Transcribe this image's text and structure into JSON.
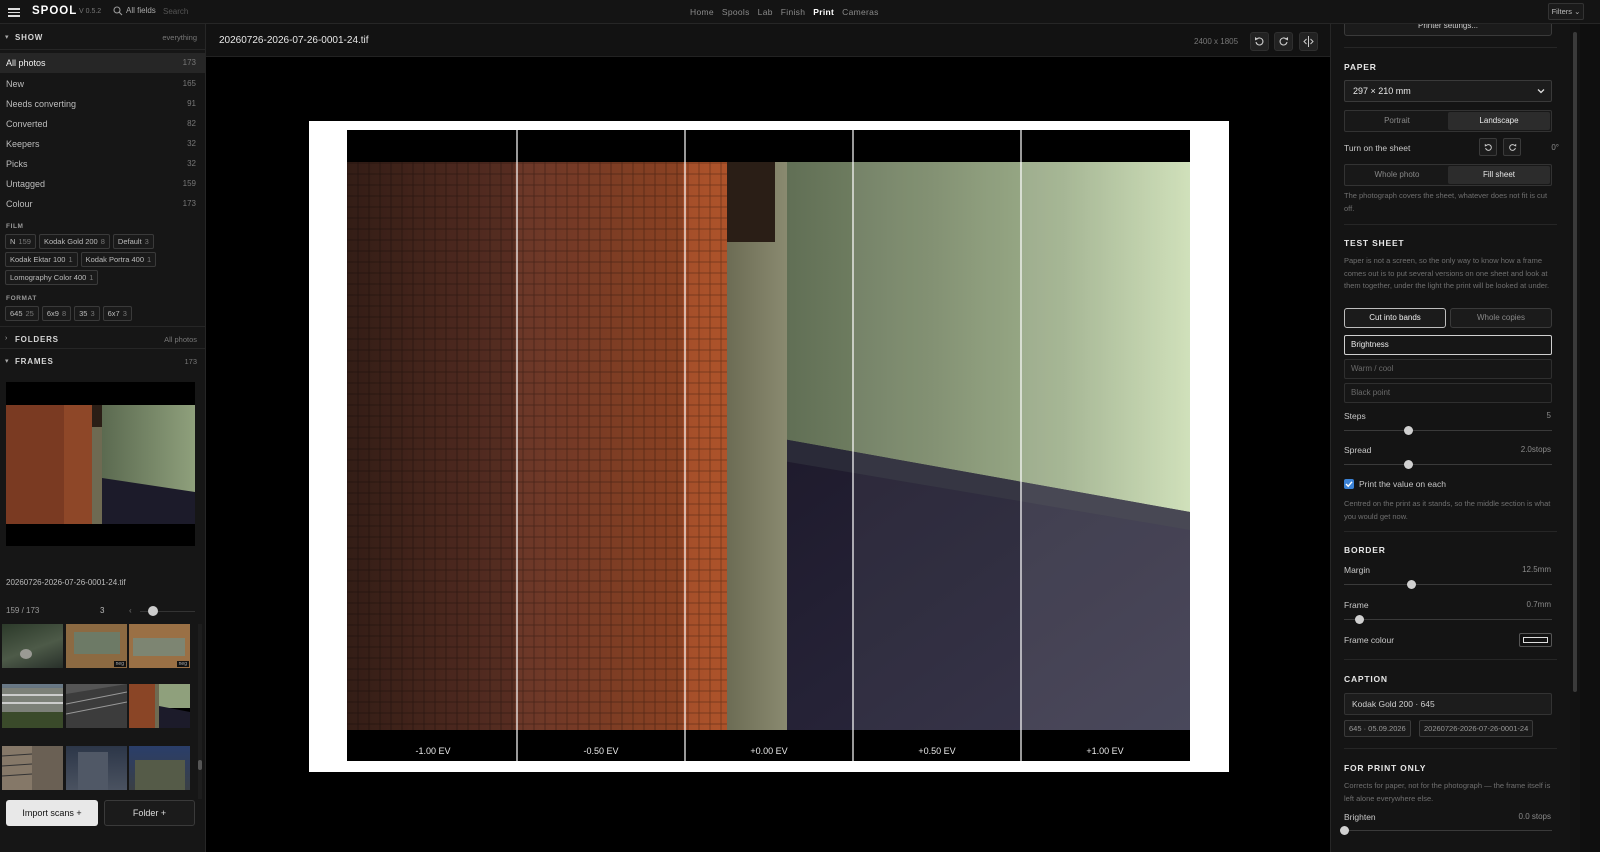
{
  "app": {
    "brand": "SPOOL",
    "version": "V 0.5.2"
  },
  "search": {
    "scope": "All fields",
    "placeholder": "Search"
  },
  "nav": {
    "items": [
      "Home",
      "Spools",
      "Lab",
      "Finish",
      "Print",
      "Cameras"
    ],
    "active": "Print"
  },
  "toolbar": {
    "filters_label": "Filters"
  },
  "show": {
    "title": "SHOW",
    "meta": "everything",
    "items": [
      {
        "label": "All photos",
        "count": "173"
      },
      {
        "label": "New",
        "count": "165"
      },
      {
        "label": "Needs converting",
        "count": "91"
      },
      {
        "label": "Converted",
        "count": "82"
      },
      {
        "label": "Keepers",
        "count": "32"
      },
      {
        "label": "Picks",
        "count": "32"
      },
      {
        "label": "Untagged",
        "count": "159"
      },
      {
        "label": "Colour",
        "count": "173"
      }
    ]
  },
  "film": {
    "label": "FILM",
    "chips": [
      {
        "label": "N",
        "count": "159"
      },
      {
        "label": "Kodak Gold 200",
        "count": "8"
      },
      {
        "label": "Default",
        "count": "3"
      },
      {
        "label": "Kodak Ektar 100",
        "count": "1"
      },
      {
        "label": "Kodak Portra 400",
        "count": "1"
      },
      {
        "label": "Lomography Color 400",
        "count": "1"
      }
    ]
  },
  "format": {
    "label": "FORMAT",
    "chips": [
      {
        "label": "645",
        "count": "25"
      },
      {
        "label": "6x9",
        "count": "8"
      },
      {
        "label": "35",
        "count": "3"
      },
      {
        "label": "6x7",
        "count": "3"
      }
    ]
  },
  "folders": {
    "title": "FOLDERS",
    "meta": "All photos"
  },
  "frames": {
    "title": "FRAMES",
    "count": "173",
    "selected_name": "20260726-2026-07-26-0001-24.tif",
    "position": "159 / 173",
    "zoom": "3",
    "neg_badge": "neg"
  },
  "actions": {
    "import_label": "Import scans +",
    "folder_label": "Folder +"
  },
  "viewer": {
    "file_title": "20260726-2026-07-26-0001-24.tif",
    "dimensions": "2400 x 1805"
  },
  "test_strip": {
    "labels": [
      "-1.00 EV",
      "-0.50 EV",
      "+0.00 EV",
      "+0.50 EV",
      "+1.00 EV"
    ]
  },
  "right": {
    "printer_settings": "Printer settings...",
    "paper": {
      "title": "PAPER",
      "size": "297 × 210 mm",
      "orientation": [
        "Portrait",
        "Landscape"
      ],
      "orientation_selected": "Landscape",
      "turn_label": "Turn on the sheet",
      "turn_value": "0°",
      "fit": [
        "Whole photo",
        "Fill sheet"
      ],
      "fit_selected": "Fill sheet",
      "fit_help": "The photograph covers the sheet, whatever does not fit is cut off."
    },
    "test_sheet": {
      "title": "TEST SHEET",
      "help": "Paper is not a screen, so the only way to know how a frame comes out is to put several versions on one sheet and look at them together, under the light the print will be looked at under.",
      "modes": [
        "Cut into bands",
        "Whole copies"
      ],
      "mode_selected": "Cut into bands",
      "variables": [
        "Brightness",
        "Warm / cool",
        "Black point"
      ],
      "variable_selected": "Brightness",
      "steps_label": "Steps",
      "steps_value": "5",
      "steps_fraction": 0.31,
      "spread_label": "Spread",
      "spread_value": "2.0stops",
      "spread_fraction": 0.31,
      "print_value_label": "Print the value on each",
      "print_value_checked": true,
      "centred_help": "Centred on the print as it stands, so the middle section is what you would get now."
    },
    "border": {
      "title": "BORDER",
      "margin_label": "Margin",
      "margin_value": "12.5mm",
      "margin_fraction": 0.32,
      "frame_label": "Frame",
      "frame_value": "0.7mm",
      "frame_fraction": 0.07,
      "frame_colour_label": "Frame colour"
    },
    "caption": {
      "title": "CAPTION",
      "text": "Kodak Gold 200 · 645",
      "tags": [
        "645 · 05.09.2026",
        "20260726-2026-07-26-0001-24"
      ]
    },
    "for_print_only": {
      "title": "FOR PRINT ONLY",
      "help": "Corrects for paper, not for the photograph — the frame itself is left alone everywhere else.",
      "brighten_label": "Brighten",
      "brighten_value": "0.0 stops",
      "brighten_fraction": 0.0
    }
  }
}
